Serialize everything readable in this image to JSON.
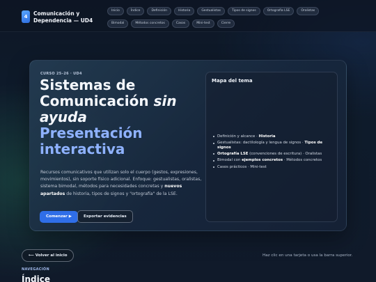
{
  "brand": {
    "badge": "4",
    "title": "Comunicación y Dependencia — UD4"
  },
  "nav": {
    "row1": [
      "Inicio",
      "Índice",
      "Definición",
      "Historia",
      "Gestualistas",
      "Tipos de signos",
      "Ortografía LSE",
      "Oralistas"
    ],
    "row2": [
      "Bimodal",
      "Métodos concretos",
      "Casos",
      "Mini-test",
      "Cierre"
    ]
  },
  "hero": {
    "eyebrow": "CURSO 25–26 · UD4",
    "title_plain": "Sistemas de Comunicación ",
    "title_em": "sin ayuda",
    "title_accent": "Presentación interactiva",
    "lead_part1": "Recursos comunicativos que utilizan solo el cuerpo (gestos, expresiones, movimientos), sin soporte físico adicional. Enfoque: gestualistas, oralistas, sistema bimodal, métodos para necesidades concretas y ",
    "lead_strong": "nuevos apartados",
    "lead_part2": " de historia, tipos de signos y \"ortografía\" de la LSE.",
    "start_label": "Comenzar ▶",
    "export_label": "Exportar evidencias"
  },
  "map": {
    "title": "Mapa del tema",
    "item1_text": "Definición y alcance · ",
    "item1_strong": "Historia",
    "item2_text": "Gestualistas: dactilología y lengua de signos · ",
    "item2_strong": "Tipos de signos",
    "item3_strong": "Ortografía LSE",
    "item3_text": " (convenciones de escritura) · Oralistas",
    "item4_text": "Bimodal con ",
    "item4_strong": "ejemplos concretos",
    "item4_text2": " · Métodos concretos",
    "item5_text": "Casos prácticos · Mini-test"
  },
  "footer": {
    "back_label": "⟵ Volver al inicio",
    "hint": "Haz clic en una tarjeta o usa la barra superior.",
    "section_label": "NAVEGACIÓN",
    "section_title": "Índice"
  }
}
